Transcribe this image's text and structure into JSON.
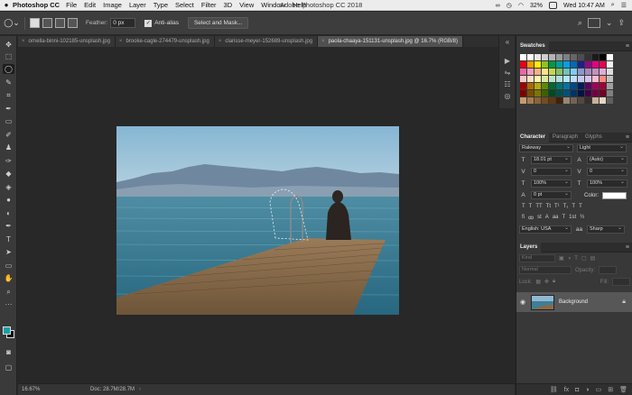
{
  "menubar": {
    "app_name": "Photoshop CC",
    "items": [
      "File",
      "Edit",
      "Image",
      "Layer",
      "Type",
      "Select",
      "Filter",
      "3D",
      "View",
      "Window",
      "Help"
    ],
    "window_title": "Adobe Photoshop CC 2018",
    "battery": "32%",
    "clock": "Wed 10:47 AM"
  },
  "options": {
    "feather_label": "Feather:",
    "feather_value": "0 px",
    "antialias_label": "Anti-alias",
    "select_mask_label": "Select and Mask..."
  },
  "tabs": [
    {
      "label": "ornella-binni-102185-unsplash.jpg"
    },
    {
      "label": "brooke-cagle-274479-unsplash.jpg"
    },
    {
      "label": "clarisse-meyer-152689-unsplash.jpg"
    },
    {
      "label": "paola-chaaya-151131-unsplash.jpg @ 16.7% (RGB/8)"
    }
  ],
  "status": {
    "zoom": "16.67%",
    "doc_size": "Doc: 28.7M/28.7M"
  },
  "swatches_panel": {
    "title": "Swatches",
    "colors": [
      "#ffffff",
      "#ffffff",
      "#e8e8e8",
      "#cfcfcf",
      "#b3b3b3",
      "#999999",
      "#808080",
      "#666666",
      "#4d4d4d",
      "#333333",
      "#1a1a1a",
      "#000000",
      "#ffffff",
      "#e60012",
      "#f39800",
      "#fff100",
      "#8fc31f",
      "#009944",
      "#009e96",
      "#00a0e9",
      "#0068b7",
      "#1d2088",
      "#920783",
      "#e4007f",
      "#e5004f",
      "#f2f2f2",
      "#ea68a2",
      "#f19ec2",
      "#f6b37f",
      "#ffe289",
      "#c3d94e",
      "#86c166",
      "#6fc3bb",
      "#7ecef4",
      "#8c97cb",
      "#a688bd",
      "#c490bf",
      "#e3aad6",
      "#dddddd",
      "#f8c8c8",
      "#fce2c4",
      "#fff9b1",
      "#dbe8a3",
      "#c1e1c5",
      "#b2dfdb",
      "#b3e5fc",
      "#bbdefb",
      "#c5cae9",
      "#d1c4e9",
      "#f8bbd0",
      "#ff8a80",
      "#c0c0c0",
      "#a40000",
      "#ad6a00",
      "#b7aa00",
      "#5d8a00",
      "#006934",
      "#00736d",
      "#0074a5",
      "#004986",
      "#001e5a",
      "#5d005f",
      "#a1005b",
      "#a20036",
      "#a0a0a0",
      "#7d0000",
      "#7a4c00",
      "#7e7500",
      "#3f6000",
      "#004a24",
      "#00514c",
      "#005177",
      "#003366",
      "#00143f",
      "#410043",
      "#700041",
      "#700025",
      "#808080",
      "#c69c6d",
      "#a67c52",
      "#8c6239",
      "#754c24",
      "#603913",
      "#42210b",
      "#998675",
      "#736357",
      "#534741",
      "#362f2d",
      "#c7b299",
      "#e6d5c3",
      "#606060"
    ]
  },
  "character_panel": {
    "tabs": [
      "Character",
      "Paragraph",
      "Glyphs"
    ],
    "font_family": "Raleway",
    "font_style": "Light",
    "font_size": "18.01 pt",
    "leading": "(Auto)",
    "kerning": "0",
    "tracking": "0",
    "vertical_scale": "100%",
    "horizontal_scale": "100%",
    "baseline_shift": "0 pt",
    "color_label": "Color:",
    "type_buttons": [
      "T",
      "T",
      "TT",
      "Tt",
      "T¹",
      "T₁",
      "T",
      "T"
    ],
    "opentype_buttons": [
      "fi",
      "ꝏ",
      "st",
      "A",
      "aa",
      "T",
      "1st",
      "½"
    ],
    "language": "English: USA",
    "aa_icon": "aa",
    "antialiasing": "Sharp"
  },
  "layers_panel": {
    "title": "Layers",
    "kind_label": "Kind",
    "blend_mode": "Normal",
    "opacity_label": "Opacity:",
    "lock_label": "Lock:",
    "fill_label": "Fill:",
    "layer_name": "Background"
  }
}
